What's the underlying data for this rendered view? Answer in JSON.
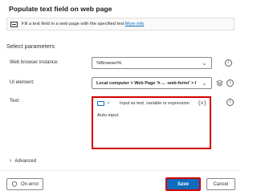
{
  "dialog": {
    "title": "Populate text field on web page",
    "info_text": "Fill a text field in a web page with the specified text",
    "info_link": "More info"
  },
  "parameters": {
    "section_title": "Select parameters",
    "browser": {
      "label": "Web browser instance:",
      "value": "%Browser%"
    },
    "ui_element": {
      "label": "UI element:",
      "value": "Local computer > Web Page 'h ... -web-form/' > I"
    },
    "text": {
      "label": "Text:",
      "mode_label": "Input as text, variable or expression",
      "variable_symbol": "{x}",
      "value": "Auto input."
    },
    "advanced_label": "Advanced"
  },
  "footer": {
    "on_error_label": "On error",
    "save_label": "Save",
    "cancel_label": "Cancel"
  },
  "colors": {
    "accent": "#0f6cbd",
    "highlight": "#d40000"
  }
}
